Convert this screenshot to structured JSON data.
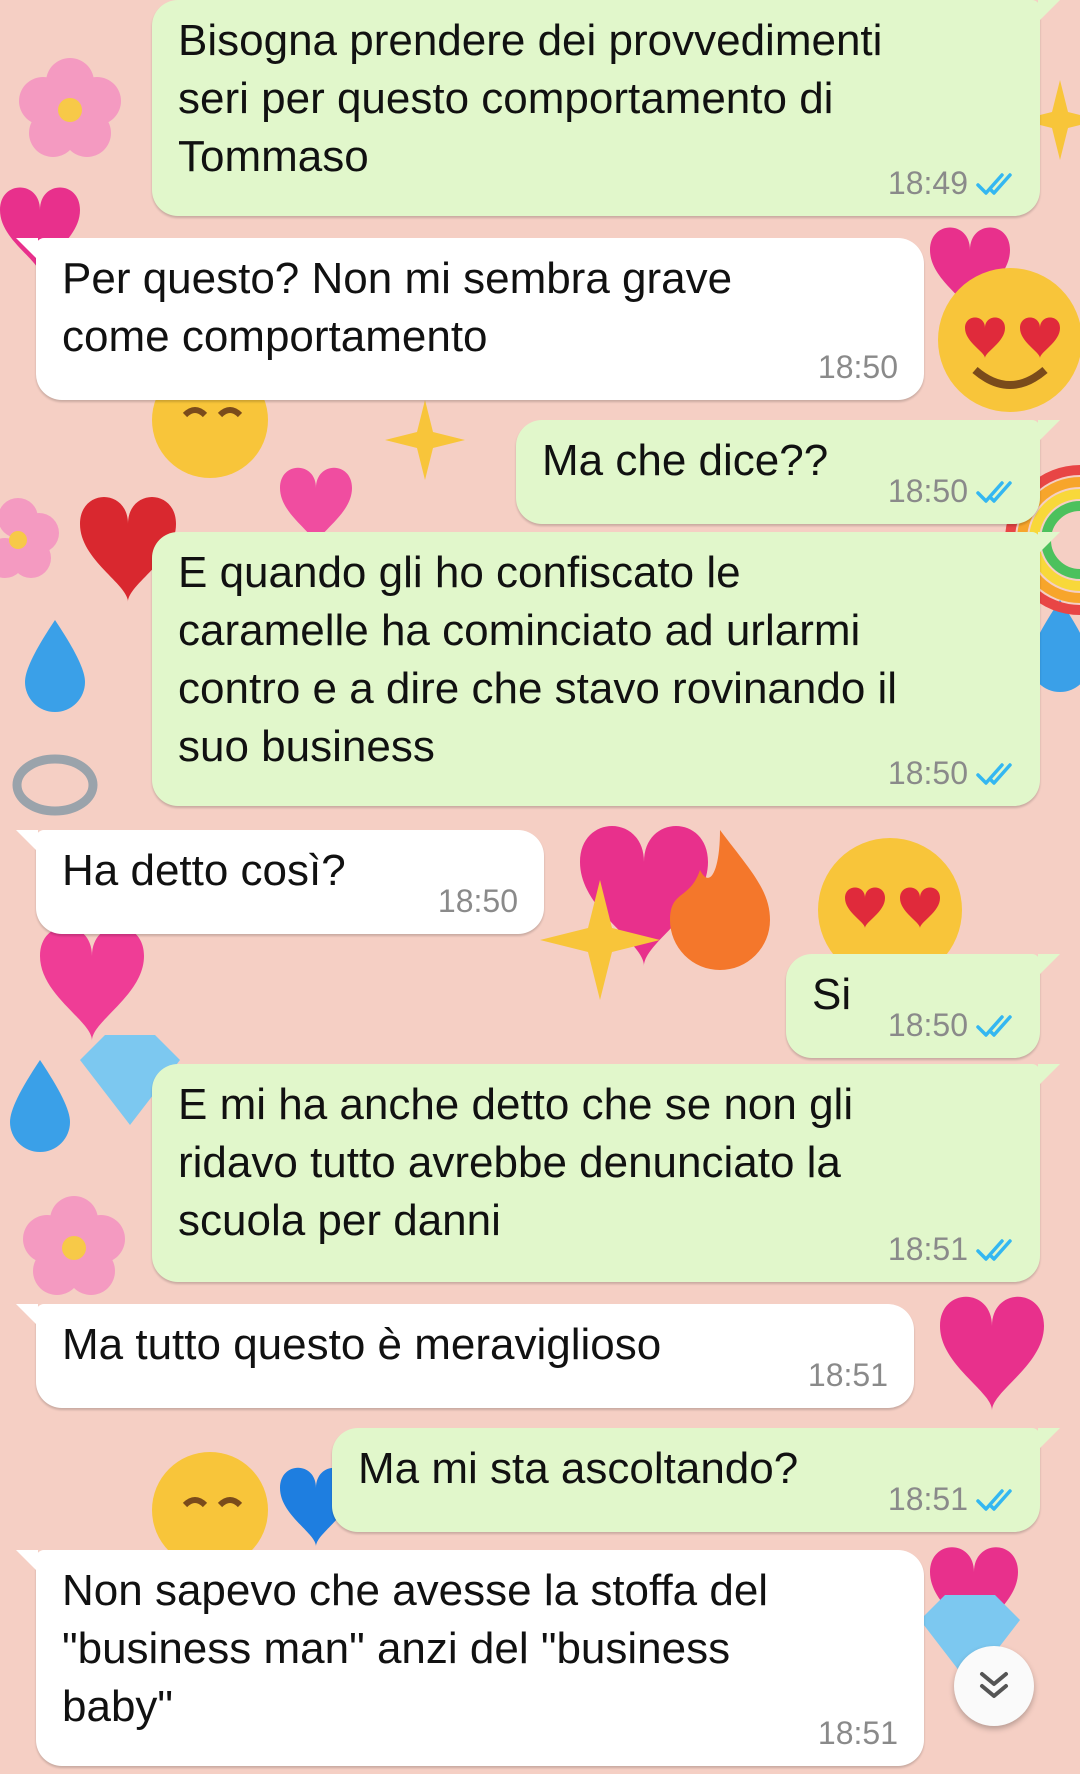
{
  "conversation": {
    "messages": [
      {
        "direction": "outgoing",
        "text": "Bisogna prendere dei provvedimenti\nseri per questo comportamento di\nTommaso",
        "time": "18:49",
        "status": "read"
      },
      {
        "direction": "incoming",
        "text": "Per questo? Non mi sembra grave\ncome comportamento",
        "time": "18:50"
      },
      {
        "direction": "outgoing",
        "text": "Ma che dice??",
        "time": "18:50",
        "status": "read"
      },
      {
        "direction": "outgoing",
        "text": "E quando gli ho confiscato le\ncaramelle ha cominciato ad urlarmi\ncontro e a dire che stavo rovinando il\nsuo business",
        "time": "18:50",
        "status": "read"
      },
      {
        "direction": "incoming",
        "text": "Ha detto così?",
        "time": "18:50"
      },
      {
        "direction": "outgoing",
        "text": "Si",
        "time": "18:50",
        "status": "read"
      },
      {
        "direction": "outgoing",
        "text": "E mi ha anche detto che se non gli\nridavo tutto avrebbe denunciato la\nscuola per danni",
        "time": "18:51",
        "status": "read"
      },
      {
        "direction": "incoming",
        "text": "Ma tutto questo è meraviglioso",
        "time": "18:51"
      },
      {
        "direction": "outgoing",
        "text": "Ma mi sta ascoltando?",
        "time": "18:51",
        "status": "read"
      },
      {
        "direction": "incoming",
        "text": "Non sapevo che avesse la stoffa del\n\"business man\" anzi del \"business\nbaby\"",
        "time": "18:51"
      }
    ]
  },
  "scroll_button": {
    "icon": "double-chevron-down-icon"
  },
  "colors": {
    "wallpaper": "#f5cfc4",
    "outgoing_bubble": "#e1f7cb",
    "incoming_bubble": "#ffffff",
    "read_ticks": "#34b7f1",
    "timestamp": "#8a8a8a"
  }
}
